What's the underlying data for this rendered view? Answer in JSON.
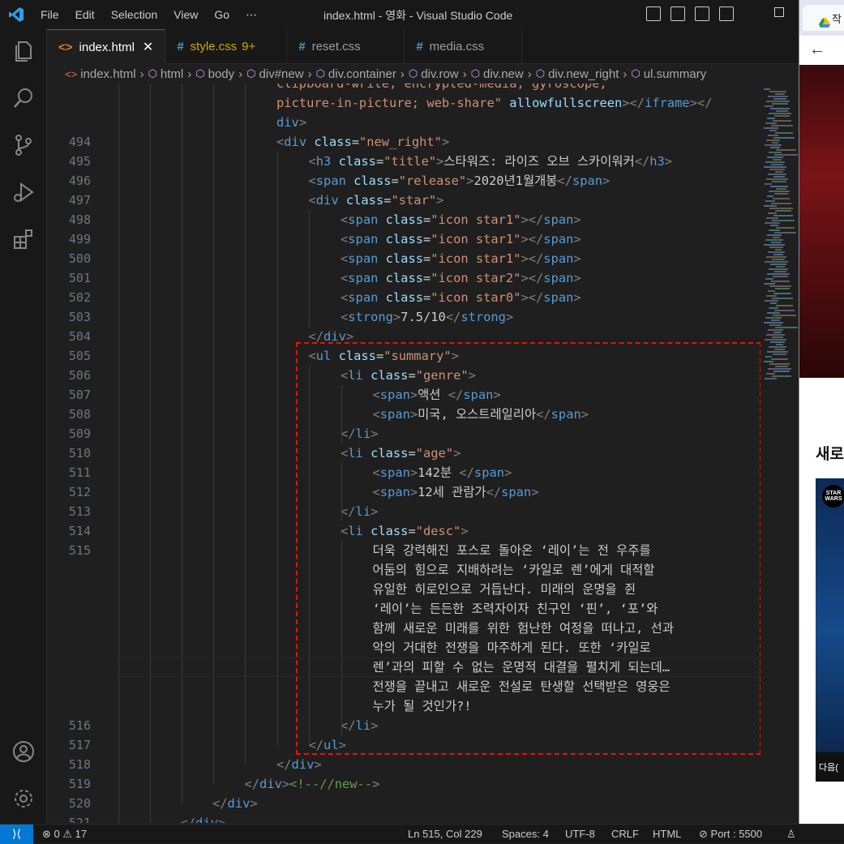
{
  "titlebar": {
    "menu": [
      "File",
      "Edit",
      "Selection",
      "View",
      "Go",
      "⋯"
    ],
    "title": "index.html - 영화 - Visual Studio Code"
  },
  "tabs": [
    {
      "icon": "<>",
      "label": "index.html",
      "close": "✕"
    },
    {
      "icon": "#",
      "label": "style.css",
      "badge": "9+"
    },
    {
      "icon": "#",
      "label": "reset.css"
    },
    {
      "icon": "#",
      "label": "media.css"
    }
  ],
  "breadcrumb": [
    "index.html",
    "html",
    "body",
    "div#new",
    "div.container",
    "div.row",
    "div.new",
    "div.new_right",
    "ul.summary"
  ],
  "editor": {
    "pre_lines": [
      "clipboard-write; encrypted-media; gyroscope;",
      "picture-in-picture; web-share\" allowfullscreen></iframe></",
      "div>"
    ],
    "lines": [
      {
        "n": "494",
        "text": "<div class=\"new_right\">"
      },
      {
        "n": "495",
        "text": "<h3 class=\"title\">스타워즈: 라이즈 오브 스카이워커</h3>"
      },
      {
        "n": "496",
        "text": "<span class=\"release\">2020년1월개봉</span>"
      },
      {
        "n": "497",
        "text": "<div class=\"star\">"
      },
      {
        "n": "498",
        "text": "<span class=\"icon star1\"></span>"
      },
      {
        "n": "499",
        "text": "<span class=\"icon star1\"></span>"
      },
      {
        "n": "500",
        "text": "<span class=\"icon star1\"></span>"
      },
      {
        "n": "501",
        "text": "<span class=\"icon star2\"></span>"
      },
      {
        "n": "502",
        "text": "<span class=\"icon star0\"></span>"
      },
      {
        "n": "503",
        "text": "<strong>7.5/10</strong>"
      },
      {
        "n": "504",
        "text": "</div>"
      },
      {
        "n": "505",
        "text": "<ul class=\"summary\">"
      },
      {
        "n": "506",
        "text": "<li class=\"genre\">"
      },
      {
        "n": "507",
        "text": "<span>액션 </span>"
      },
      {
        "n": "508",
        "text": "<span>미국, 오스트레일리아</span>"
      },
      {
        "n": "509",
        "text": "</li>"
      },
      {
        "n": "510",
        "text": "<li class=\"age\">"
      },
      {
        "n": "511",
        "text": "<span>142분 </span>"
      },
      {
        "n": "512",
        "text": "<span>12세 관람가</span>"
      },
      {
        "n": "513",
        "text": "</li>"
      },
      {
        "n": "514",
        "text": "<li class=\"desc\">"
      },
      {
        "n": "515",
        "text": "더욱 강력해진 포스로 돌아온 ‘레이’는 전 우주를"
      },
      {
        "n": "",
        "text": "어둠의 힘으로 지배하려는 ‘카일로 렌’에게 대적할"
      },
      {
        "n": "",
        "text": "유일한 히로인으로 거듭난다. 미래의 운명을 쥔"
      },
      {
        "n": "",
        "text": "‘레이’는 든든한 조력자이자 친구인 ‘핀’, ‘포’와"
      },
      {
        "n": "",
        "text": "함께 새로운 미래를 위한 험난한 여정을 떠나고, 선과"
      },
      {
        "n": "",
        "text": "악의 거대한 전쟁을 마주하게 된다. 또한 ‘카일로"
      },
      {
        "n": "",
        "text": "렌’과의 피할 수 없는 운명적 대결을 펼치게 되는데…"
      },
      {
        "n": "",
        "text": "전쟁을 끝내고 새로운 전설로 탄생할 선택받은 영웅은"
      },
      {
        "n": "",
        "text": "누가 될 것인가?!"
      },
      {
        "n": "516",
        "text": "</li>"
      },
      {
        "n": "517",
        "text": "</ul>"
      },
      {
        "n": "518",
        "text": "</div>"
      },
      {
        "n": "519",
        "text": "</div><!--//new-->"
      },
      {
        "n": "520",
        "text": "</div>"
      },
      {
        "n": "521",
        "text": "</div>"
      }
    ]
  },
  "browser": {
    "tab_label": "작",
    "back": "←",
    "forward": "→",
    "section_heading": "새로",
    "poster_logo": "STAR WARS",
    "poster_caption": "다음("
  },
  "statusbar": {
    "remote": "⟩⟨",
    "errors": "0",
    "warnings": "17",
    "position": "Ln 515, Col 229",
    "spaces": "Spaces: 4",
    "encoding": "UTF-8",
    "eol": "CRLF",
    "language": "HTML",
    "port": "Port : 5500"
  }
}
